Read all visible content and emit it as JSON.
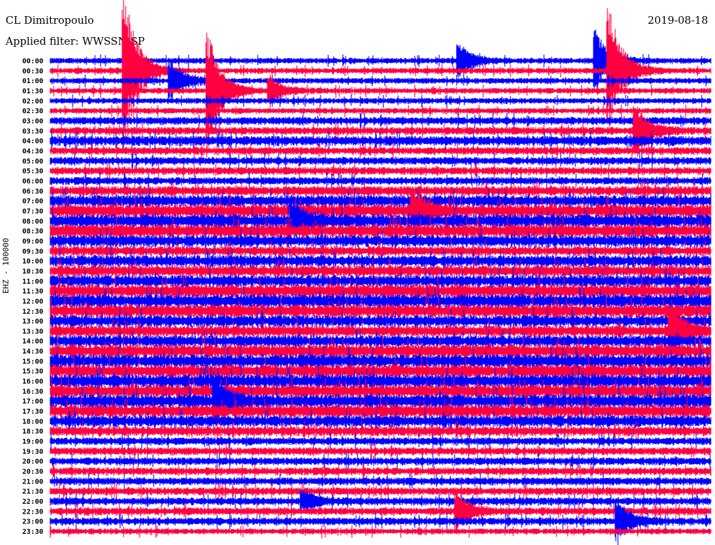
{
  "header": {
    "station": "CL Dimitropoulo",
    "filter": "Applied filter: WWSSN-SP",
    "date": "2019-08-18"
  },
  "chart_data": {
    "type": "line",
    "title": "CL Dimitropoulo",
    "ylabel": "EHZ - 100000",
    "row_minutes": 30,
    "row_labels": [
      "00:00",
      "00:30",
      "01:00",
      "01:30",
      "02:00",
      "02:30",
      "03:00",
      "03:30",
      "04:00",
      "04:30",
      "05:00",
      "05:30",
      "06:00",
      "06:30",
      "07:00",
      "07:30",
      "08:00",
      "08:30",
      "09:00",
      "09:30",
      "10:00",
      "10:30",
      "11:00",
      "11:30",
      "12:00",
      "12:30",
      "13:00",
      "13:30",
      "14:00",
      "14:30",
      "15:00",
      "15:30",
      "16:00",
      "16:30",
      "17:00",
      "17:30",
      "18:00",
      "18:30",
      "19:00",
      "19:30",
      "20:00",
      "20:30",
      "21:00",
      "21:30",
      "22:00",
      "22:30",
      "23:00",
      "23:30"
    ],
    "colors": [
      "#0000ff",
      "#ff0040"
    ],
    "noise_level": [
      3,
      3,
      3,
      3,
      3,
      3,
      4,
      4,
      5,
      4,
      4,
      4,
      4,
      5,
      6,
      7,
      7,
      7,
      6,
      5,
      6,
      6,
      6,
      7,
      7,
      7,
      6,
      6,
      6,
      7,
      7,
      7,
      7,
      7,
      7,
      7,
      6,
      5,
      4,
      4,
      4,
      4,
      4,
      4,
      4,
      4,
      4,
      3
    ],
    "events": [
      {
        "row": 1,
        "minute": 3.4,
        "amp": 110
      },
      {
        "row": 3,
        "minute": 7.2,
        "amp": 85
      },
      {
        "row": 2,
        "minute": 5.5,
        "amp": 30
      },
      {
        "row": 1,
        "minute": 25.4,
        "amp": 90
      },
      {
        "row": 0,
        "minute": 24.8,
        "amp": 40
      },
      {
        "row": 0,
        "minute": 18.6,
        "amp": 25
      },
      {
        "row": 3,
        "minute": 10.0,
        "amp": 20
      },
      {
        "row": 7,
        "minute": 26.6,
        "amp": 35
      },
      {
        "row": 27,
        "minute": 28.2,
        "amp": 40
      },
      {
        "row": 34,
        "minute": 7.5,
        "amp": 35
      },
      {
        "row": 44,
        "minute": 11.5,
        "amp": 15
      },
      {
        "row": 45,
        "minute": 18.5,
        "amp": 25
      },
      {
        "row": 46,
        "minute": 25.8,
        "amp": 30
      },
      {
        "row": 15,
        "minute": 16.5,
        "amp": 25
      },
      {
        "row": 16,
        "minute": 11.0,
        "amp": 25
      }
    ]
  }
}
